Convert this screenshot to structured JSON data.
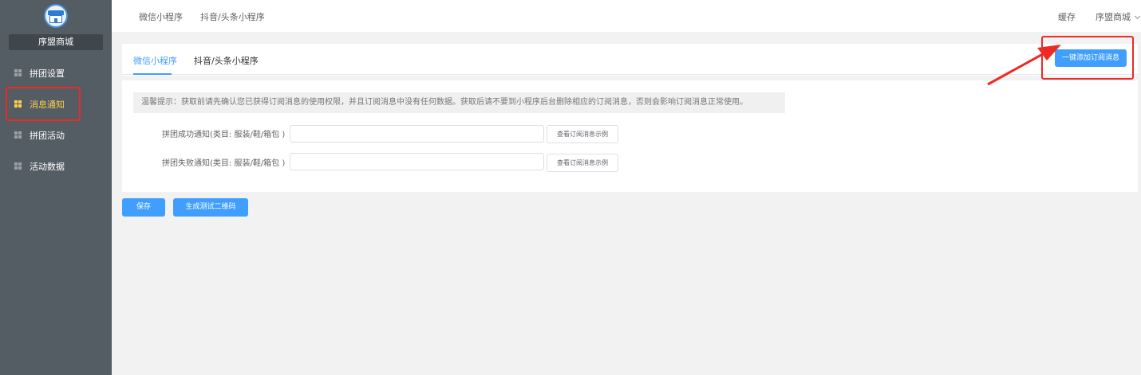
{
  "sidebar": {
    "shop_name": "序盟商城",
    "items": [
      {
        "label": "拼团设置",
        "active": false
      },
      {
        "label": "消息通知",
        "active": true
      },
      {
        "label": "拼团活动",
        "active": false
      },
      {
        "label": "活动数据",
        "active": false
      }
    ]
  },
  "topbar": {
    "tabs": [
      "微信小程序",
      "抖音/头条小程序"
    ],
    "cache": "缓存",
    "shop_menu": "序盟商城"
  },
  "subtabs": {
    "items": [
      "微信小程序",
      "抖音/头条小程序"
    ],
    "active_index": 0
  },
  "actions": {
    "add_subscribe": "一键添加订阅消息",
    "save": "保存",
    "gen_qr": "生成测试二维码"
  },
  "form": {
    "tip": "温馨提示：获取前请先确认您已获得订阅消息的使用权限，并且订阅消息中没有任何数据。获取后请不要到小程序后台删除相应的订阅消息，否则会影响订阅消息正常使用。",
    "fields": [
      {
        "label": "拼团成功通知(类目: 服装/鞋/箱包 )",
        "value": "",
        "example_btn": "查看订阅消息示例"
      },
      {
        "label": "拼团失败通知(类目: 服装/鞋/箱包 )",
        "value": "",
        "example_btn": "查看订阅消息示例"
      }
    ]
  },
  "colors": {
    "sidebar_bg": "#545c64",
    "active_menu": "#ffd04b",
    "primary": "#409eff",
    "annotation_red": "#ee2a24"
  }
}
